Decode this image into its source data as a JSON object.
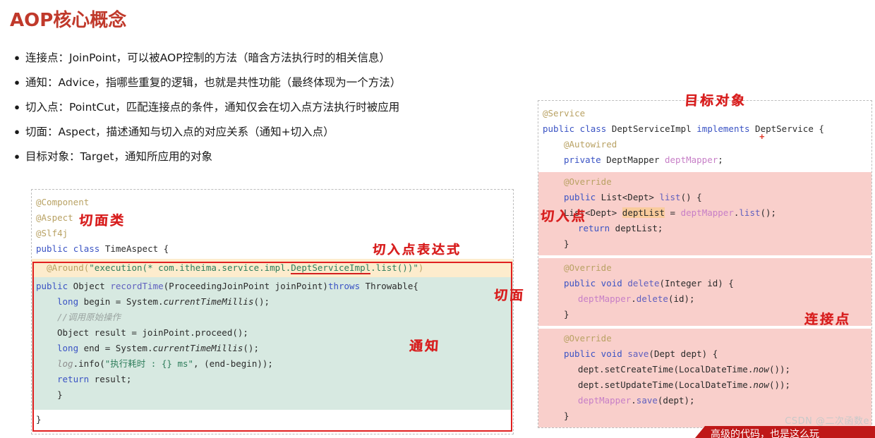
{
  "page": {
    "title": "AOP核心概念",
    "watermark": "CSDN @二次函数e"
  },
  "bullets": [
    {
      "dot": "●",
      "text": "连接点：JoinPoint，可以被AOP控制的方法（暗含方法执行时的相关信息）"
    },
    {
      "dot": "●",
      "text": "通知：Advice，指哪些重复的逻辑，也就是共性功能（最终体现为一个方法）"
    },
    {
      "dot": "●",
      "text": "切入点：PointCut，匹配连接点的条件，通知仅会在切入点方法执行时被应用"
    },
    {
      "dot": "●",
      "text": "切面：Aspect，描述通知与切入点的对应关系（通知+切入点）"
    },
    {
      "dot": "●",
      "text": "目标对象：Target，通知所应用的对象"
    }
  ],
  "left_code": {
    "lines": [
      "@Component",
      "@Aspect",
      "@Slf4j",
      "public class TimeAspect {",
      "    @Around(\"execution(* com.itheima.service.impl.DeptServiceImpl.list())\")",
      "    public Object recordTime(ProceedingJoinPoint joinPoint)throws Throwable{",
      "        long begin = System.currentTimeMillis();",
      "        //调用原始操作",
      "        Object result = joinPoint.proceed();",
      "        long end = System.currentTimeMillis();",
      "        log.info(\"执行耗时 : {} ms\", (end-begin));",
      "        return result;",
      "    }",
      "}"
    ],
    "l1": "@Component",
    "l2": "@Aspect",
    "l3": "@Slf4j",
    "l4_kw1": "public",
    "l4_kw2": "class",
    "l4_name": "TimeAspect {",
    "l5_ann": "@Around(",
    "l5_str_a": "\"execution(* com.itheima.service.impl.",
    "l5_str_b": "DeptServiceImpl",
    "l5_str_c": ".list())\"",
    "l5_end": ")",
    "l6_kw1": "public",
    "l6_type": " Object ",
    "l6_meth": "recordTime",
    "l6_params": "(ProceedingJoinPoint joinPoint)",
    "l6_kw2": "throws",
    "l6_tail": " Throwable{",
    "l7_kw": "long",
    "l7_rest": " begin = System.",
    "l7_ital": "currentTimeMillis",
    "l7_end": "();",
    "l8_cmt": "//调用原始操作",
    "l9": "Object result = joinPoint.proceed();",
    "l10_kw": "long",
    "l10_rest": " end = System.",
    "l10_ital": "currentTimeMillis",
    "l10_end": "();",
    "l11_log": "log",
    "l11_a": ".info(",
    "l11_str1": "\"",
    "l11_str_cn": "执行耗时",
    "l11_str2": " : ",
    "l11_brace": "{}",
    "l11_str3": " ms\"",
    "l11_b": ", (end-begin));",
    "l12_kw": "return",
    "l12_rest": " result;",
    "l13": "    }",
    "l14": "}"
  },
  "right_code": {
    "lines": [
      "@Service",
      "public class DeptServiceImpl implements DeptService {",
      "    @Autowired",
      "    private DeptMapper deptMapper;",
      "    @Override",
      "    public List<Dept> list() {",
      "        List<Dept> deptList = deptMapper.list();",
      "        return deptList;",
      "    }",
      "    @Override",
      "    public void delete(Integer id) {",
      "        deptMapper.delete(id);",
      "    }",
      "    @Override",
      "    public void save(Dept dept) {",
      "        dept.setCreateTime(LocalDateTime.now());",
      "        dept.setUpdateTime(LocalDateTime.now());",
      "        deptMapper.save(dept);",
      "    }"
    ],
    "r1": "@Service",
    "r2_kw1": "public",
    "r2_kw2": " class ",
    "r2_name": "DeptServiceImpl ",
    "r2_kw3": "implements",
    "r2_tail": " DeptService {",
    "r3": "@Autowired",
    "r4_kw": "private",
    "r4_type": " DeptMapper ",
    "r4_field": "deptMapper",
    "r4_end": ";",
    "r5": "@Override",
    "r6_kw": "public",
    "r6_type": " List<Dept> ",
    "r6_meth": "list",
    "r6_tail": "() {",
    "r7_a": "List<Dept> ",
    "r7_hl": "deptList",
    "r7_b": " = ",
    "r7_field": "deptMapper",
    "r7_c": ".",
    "r7_meth": "list",
    "r7_end": "();",
    "r8_kw": "return",
    "r8_rest": " deptList;",
    "r9": "}",
    "r10": "@Override",
    "r11_kw1": "public",
    "r11_kw2": " void ",
    "r11_meth": "delete",
    "r11_tail": "(Integer id) {",
    "r12_field": "deptMapper",
    "r12_a": ".",
    "r12_meth": "delete",
    "r12_end": "(id);",
    "r13": "}",
    "r14": "@Override",
    "r15_kw1": "public",
    "r15_kw2": " void ",
    "r15_meth": "save",
    "r15_tail": "(Dept dept) {",
    "r16_a": "dept.setCreateTime(LocalDateTime.",
    "r16_ital": "now",
    "r16_end": "());",
    "r17_a": "dept.setUpdateTime(LocalDateTime.",
    "r17_ital": "now",
    "r17_end": "());",
    "r18_field": "deptMapper",
    "r18_a": ".",
    "r18_meth": "save",
    "r18_end": "(dept);",
    "r19": "}"
  },
  "annotations": {
    "aspect_class": "切面类",
    "pointcut_expression": "切入点表达式",
    "aspect": "切面",
    "advice": "通知",
    "target_object": "目标对象",
    "pointcut": "切入点",
    "joinpoint": "连接点",
    "plus": "+"
  },
  "banner": {
    "text": "高级的代码，也是这么玩"
  },
  "colors": {
    "title_red": "#c0392b",
    "annotation_red": "#d81f1f",
    "frame_red": "#e02020",
    "highlight_green": "#d7e9e1",
    "highlight_pink": "#f9cfcb",
    "highlight_cream": "#fdeccd",
    "highlight_orange": "#f9cb9c",
    "banner_red": "#bf1818"
  }
}
